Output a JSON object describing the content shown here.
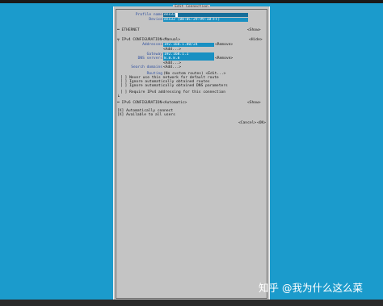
{
  "dialog": {
    "title": "Edit Connection",
    "profile_name_label": "Profile name",
    "profile_name_value": "ens32",
    "device_label": "Device",
    "device_value": "ens32 (00:0C:29:99:1B:FF)",
    "ethernet": {
      "label": "ETHERNET",
      "button": "<Show>"
    },
    "ipv4": {
      "label": "IPv4 CONFIGURATION",
      "mode": "<Manual>",
      "hide_button": "<Hide>",
      "addresses_label": "Addresses",
      "address_value": "192.168.1.80/24",
      "remove_label": "<Remove>",
      "add_label": "<Add...>",
      "gateway_label": "Gateway",
      "gateway_value": "192.168.1.1",
      "dns_label": "DNS servers",
      "dns_value": "8.8.8.8",
      "search_label": "Search domains",
      "routing_label": "Routing",
      "routing_value": "(No custom routes) <Edit...>",
      "options": [
        "[ ] Never use this network for default route",
        "[ ] Ignore automatically obtained routes",
        "[ ] Ignore automatically obtained DNS parameters"
      ],
      "require": "[ ] Require IPv4 addressing for this connection"
    },
    "ipv6": {
      "label": "IPv6 CONFIGURATION",
      "mode": "<Automatic>",
      "button": "<Show>"
    },
    "auto_connect": "[X] Automatically connect",
    "all_users": "[X] Available to all users",
    "cancel": "<Cancel>",
    "ok": "<OK>"
  },
  "watermark": "知乎 @我为什么这么菜"
}
